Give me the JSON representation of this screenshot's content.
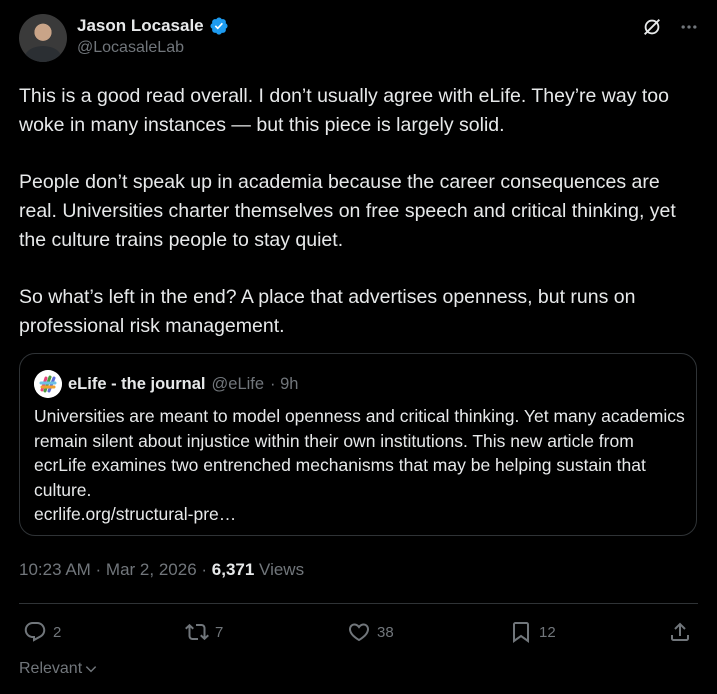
{
  "author": {
    "name": "Jason Locasale",
    "handle": "@LocasaleLab"
  },
  "tweet": {
    "paragraphs": [
      "This is a good read overall.  I don’t usually agree with eLife.  They’re way too woke in many instances — but this piece is largely solid.",
      "People don’t speak up in academia because the career consequences are real.  Universities charter themselves on free speech and critical thinking, yet the culture trains people to stay quiet.",
      "So what’s left in the end? A place that advertises openness, but runs on professional risk management."
    ]
  },
  "quote": {
    "name": "eLife - the journal",
    "handle": "@eLife",
    "time": "· 9h",
    "text": "Universities are meant to model openness and critical thinking. Yet many academics remain silent about injustice within their own institutions. This new article from ecrLife examines two entrenched mechanisms that may be helping sustain that culture.",
    "link": "ecrlife.org/structural-pre…"
  },
  "meta": {
    "datetime": "10:23 AM · Mar 2, 2026 · ",
    "views_count": "6,371",
    "views_label": " Views"
  },
  "actions": {
    "replies": "2",
    "reposts": "7",
    "likes": "38",
    "bookmarks": "12"
  },
  "sort": {
    "label": "Relevant"
  },
  "colors": {
    "background": "#000000",
    "text": "#e7e9ea",
    "muted": "#71767b",
    "border": "#2f3336",
    "verified": "#1d9bf0"
  },
  "icons": [
    "verified-badge-icon",
    "grok-icon",
    "more-icon",
    "reply-icon",
    "repost-icon",
    "like-icon",
    "bookmark-icon",
    "share-icon",
    "chevron-down-icon"
  ]
}
